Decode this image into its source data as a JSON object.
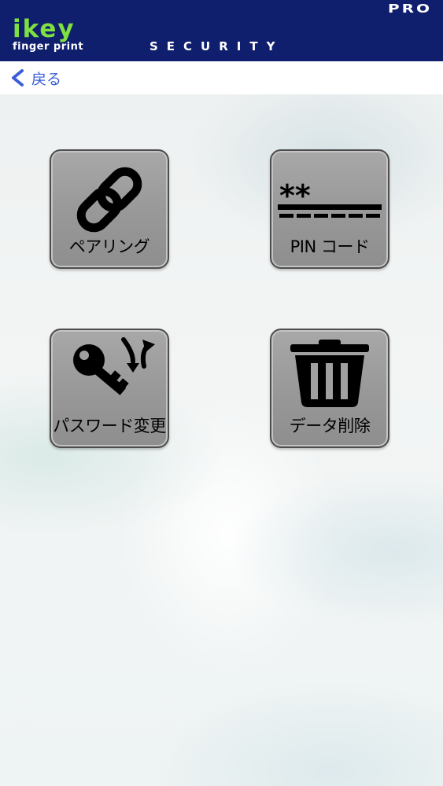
{
  "header": {
    "logo_main": "ikey",
    "logo_sub": "finger print",
    "logo_security": "SECURITY",
    "logo_pro": "PRO"
  },
  "nav": {
    "back_label": "戻る"
  },
  "menu": {
    "pairing": {
      "label": "ペアリング",
      "icon": "chain-link-icon"
    },
    "pin": {
      "label": "PIN コード",
      "icon": "pin-code-icon",
      "mask": "**"
    },
    "password": {
      "label": "パスワード変更",
      "icon": "key-change-icon"
    },
    "delete": {
      "label": "データ削除",
      "icon": "trash-icon"
    }
  },
  "colors": {
    "header_bg": "#0f1f6e",
    "logo_accent": "#7fe042",
    "back_link": "#3a5fd6",
    "tile_bg": "#9c9c9c"
  }
}
